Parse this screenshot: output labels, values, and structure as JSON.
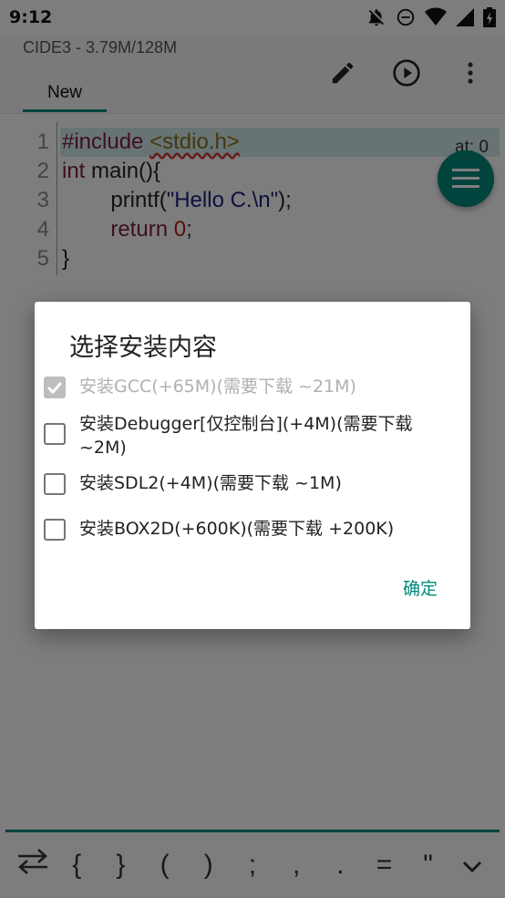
{
  "statusbar": {
    "time": "9:12"
  },
  "appbar": {
    "title": "CIDE3 - 3.79M/128M",
    "tab_label": "New",
    "actions": [
      "edit-icon",
      "run-icon",
      "more-vert-icon"
    ]
  },
  "editor": {
    "line_numbers": [
      "1",
      "2",
      "3",
      "4",
      "5"
    ],
    "cursor_position": "at: 0",
    "lines": [
      {
        "parts": [
          {
            "t": "#include ",
            "c": "kw"
          },
          {
            "t": "<stdio.h>",
            "c": "inc"
          }
        ]
      },
      {
        "parts": [
          {
            "t": "int",
            "c": "kw"
          },
          {
            "t": " main(){",
            "c": ""
          }
        ]
      },
      {
        "parts": [
          {
            "t": "        printf(",
            "c": ""
          },
          {
            "t": "\"Hello C.\\n\"",
            "c": "str"
          },
          {
            "t": ");",
            "c": ""
          }
        ]
      },
      {
        "parts": [
          {
            "t": "        ",
            "c": ""
          },
          {
            "t": "return",
            "c": "kw"
          },
          {
            "t": " ",
            "c": ""
          },
          {
            "t": "0",
            "c": "num"
          },
          {
            "t": ";",
            "c": ""
          }
        ]
      },
      {
        "parts": [
          {
            "t": "}",
            "c": ""
          }
        ]
      }
    ]
  },
  "dialog": {
    "title": "选择安装内容",
    "options": [
      {
        "label": "安装GCC(+65M)(需要下载 ~21M)",
        "checked": true,
        "disabled": true
      },
      {
        "label": "安装Debugger[仅控制台](+4M)(需要下载 ~2M)",
        "checked": false,
        "disabled": false
      },
      {
        "label": "安装SDL2(+4M)(需要下载 ~1M)",
        "checked": false,
        "disabled": false
      },
      {
        "label": "安装BOX2D(+600K)(需要下载 +200K)",
        "checked": false,
        "disabled": false
      }
    ],
    "ok_label": "确定"
  },
  "symbols": [
    "{",
    "}",
    "(",
    ")",
    ";",
    ",",
    ".",
    "=",
    "\""
  ],
  "colors": {
    "accent": "#00897b"
  }
}
